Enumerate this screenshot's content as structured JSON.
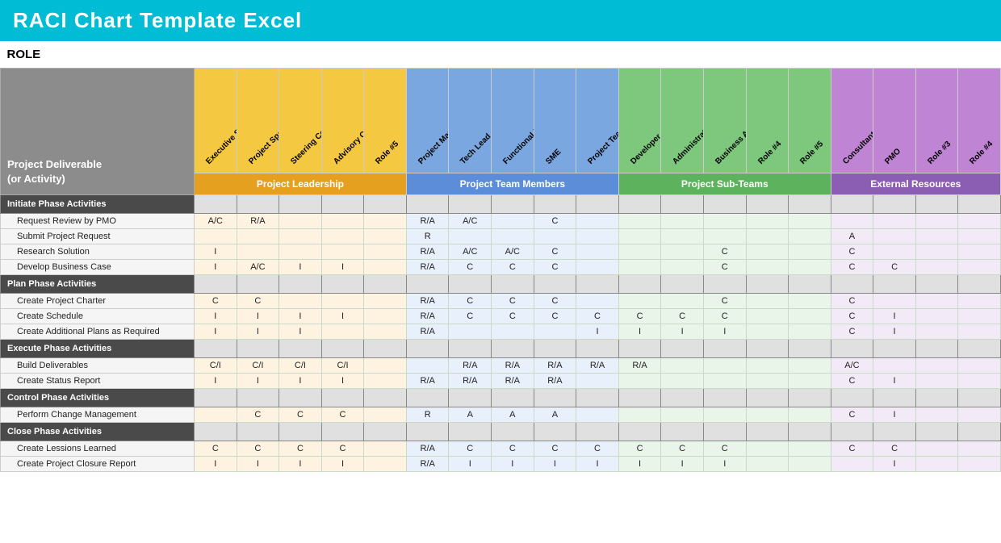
{
  "title": "RACI Chart Template Excel",
  "roleLabel": "ROLE",
  "activityHeader": "Project Deliverable\n(or Activity)",
  "groups": [
    {
      "label": "Project Leadership",
      "class": "gh-leadership",
      "colspan": 5
    },
    {
      "label": "Project Team Members",
      "class": "gh-team",
      "colspan": 5
    },
    {
      "label": "Project Sub-Teams",
      "class": "gh-subteam",
      "colspan": 5
    },
    {
      "label": "External Resources",
      "class": "gh-external",
      "colspan": 5
    }
  ],
  "columns": [
    {
      "label": "Executive Sponsor",
      "group": "leadership"
    },
    {
      "label": "Project Sponsor",
      "group": "leadership"
    },
    {
      "label": "Steering Committee",
      "group": "leadership"
    },
    {
      "label": "Advisory Committee",
      "group": "leadership"
    },
    {
      "label": "Role #5",
      "group": "leadership"
    },
    {
      "label": "Project Manager",
      "group": "team"
    },
    {
      "label": "Tech Lead",
      "group": "team"
    },
    {
      "label": "Functional Lead",
      "group": "team"
    },
    {
      "label": "SME",
      "group": "team"
    },
    {
      "label": "Project Team Member",
      "group": "team"
    },
    {
      "label": "Developer",
      "group": "subteam"
    },
    {
      "label": "Administrative Support",
      "group": "subteam"
    },
    {
      "label": "Business Analyst",
      "group": "subteam"
    },
    {
      "label": "Role #4",
      "group": "subteam"
    },
    {
      "label": "Role #5",
      "group": "subteam"
    },
    {
      "label": "Consultant",
      "group": "external"
    },
    {
      "label": "PMO",
      "group": "external"
    },
    {
      "label": "Role #3",
      "group": "external"
    },
    {
      "label": "Role #4",
      "group": "external"
    }
  ],
  "phases": [
    {
      "name": "Initiate Phase Activities",
      "activities": [
        {
          "name": "Request Review by PMO",
          "values": [
            "A/C",
            "R/A",
            "",
            "",
            "",
            "R/A",
            "A/C",
            "",
            "C",
            "",
            "",
            "",
            "",
            "",
            "",
            "",
            "",
            "",
            ""
          ]
        },
        {
          "name": "Submit Project Request",
          "values": [
            "",
            "",
            "",
            "",
            "",
            "R",
            "",
            "",
            "",
            "",
            "",
            "",
            "",
            "",
            "",
            "A",
            "",
            "",
            ""
          ]
        },
        {
          "name": "Research Solution",
          "values": [
            "I",
            "",
            "",
            "",
            "",
            "R/A",
            "A/C",
            "A/C",
            "C",
            "",
            "",
            "",
            "C",
            "",
            "",
            "C",
            "",
            "",
            ""
          ]
        },
        {
          "name": "Develop Business Case",
          "values": [
            "I",
            "A/C",
            "I",
            "I",
            "",
            "R/A",
            "C",
            "C",
            "C",
            "",
            "",
            "",
            "C",
            "",
            "",
            "C",
            "C",
            "",
            ""
          ]
        }
      ]
    },
    {
      "name": "Plan Phase Activities",
      "activities": [
        {
          "name": "Create Project Charter",
          "values": [
            "C",
            "C",
            "",
            "",
            "",
            "R/A",
            "C",
            "C",
            "C",
            "",
            "",
            "",
            "C",
            "",
            "",
            "C",
            "",
            "",
            ""
          ]
        },
        {
          "name": "Create Schedule",
          "values": [
            "I",
            "I",
            "I",
            "I",
            "",
            "R/A",
            "C",
            "C",
            "C",
            "C",
            "C",
            "C",
            "C",
            "",
            "",
            "C",
            "I",
            "",
            ""
          ]
        },
        {
          "name": "Create Additional Plans as Required",
          "values": [
            "I",
            "I",
            "I",
            "",
            "",
            "R/A",
            "",
            "",
            "",
            "I",
            "I",
            "I",
            "I",
            "",
            "",
            "C",
            "I",
            "",
            ""
          ]
        }
      ]
    },
    {
      "name": "Execute Phase Activities",
      "activities": [
        {
          "name": "Build Deliverables",
          "values": [
            "C/I",
            "C/I",
            "C/I",
            "C/I",
            "",
            "",
            "R/A",
            "R/A",
            "R/A",
            "R/A",
            "R/A",
            "",
            "",
            "",
            "",
            "A/C",
            "",
            "",
            ""
          ]
        },
        {
          "name": "Create Status Report",
          "values": [
            "I",
            "I",
            "I",
            "I",
            "",
            "R/A",
            "R/A",
            "R/A",
            "R/A",
            "",
            "",
            "",
            "",
            "",
            "",
            "C",
            "I",
            "",
            ""
          ]
        }
      ]
    },
    {
      "name": "Control Phase Activities",
      "activities": [
        {
          "name": "Perform Change Management",
          "values": [
            "",
            "C",
            "C",
            "C",
            "",
            "R",
            "A",
            "A",
            "A",
            "",
            "",
            "",
            "",
            "",
            "",
            "C",
            "I",
            "",
            ""
          ]
        }
      ]
    },
    {
      "name": "Close Phase Activities",
      "activities": [
        {
          "name": "Create Lessions Learned",
          "values": [
            "C",
            "C",
            "C",
            "C",
            "",
            "R/A",
            "C",
            "C",
            "C",
            "C",
            "C",
            "C",
            "C",
            "",
            "",
            "C",
            "C",
            "",
            ""
          ]
        },
        {
          "name": "Create Project Closure Report",
          "values": [
            "I",
            "I",
            "I",
            "I",
            "",
            "R/A",
            "I",
            "I",
            "I",
            "I",
            "I",
            "I",
            "I",
            "",
            "",
            "",
            "I",
            "",
            ""
          ]
        }
      ]
    }
  ]
}
